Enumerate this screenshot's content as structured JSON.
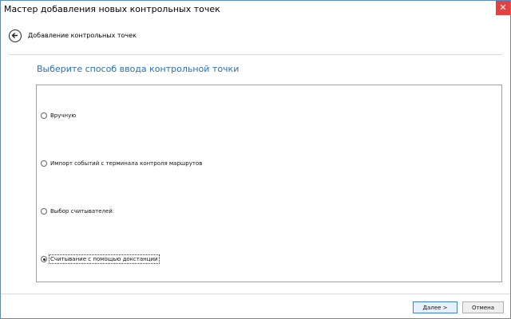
{
  "window": {
    "title": "Мастер добавления новых контрольных точек",
    "close_glyph": "✕"
  },
  "nav": {
    "back_icon": "arrow-left-circle-icon",
    "title": "Добавление контрольных точек"
  },
  "section": {
    "title": "Выберите способ ввода контрольной точки"
  },
  "options": [
    {
      "label": "Вручную",
      "checked": false
    },
    {
      "label": "Импорт событий с терминала контроля маршрутов",
      "checked": false
    },
    {
      "label": "Выбор считывателей",
      "checked": false
    },
    {
      "label": "Считывание с помощью докстанции",
      "checked": true
    }
  ],
  "footer": {
    "next_label": "Далее >",
    "cancel_label": "Отмена"
  },
  "colors": {
    "accent": "#2a6ebb",
    "close": "#e04343",
    "border": "#5b8ac8"
  }
}
